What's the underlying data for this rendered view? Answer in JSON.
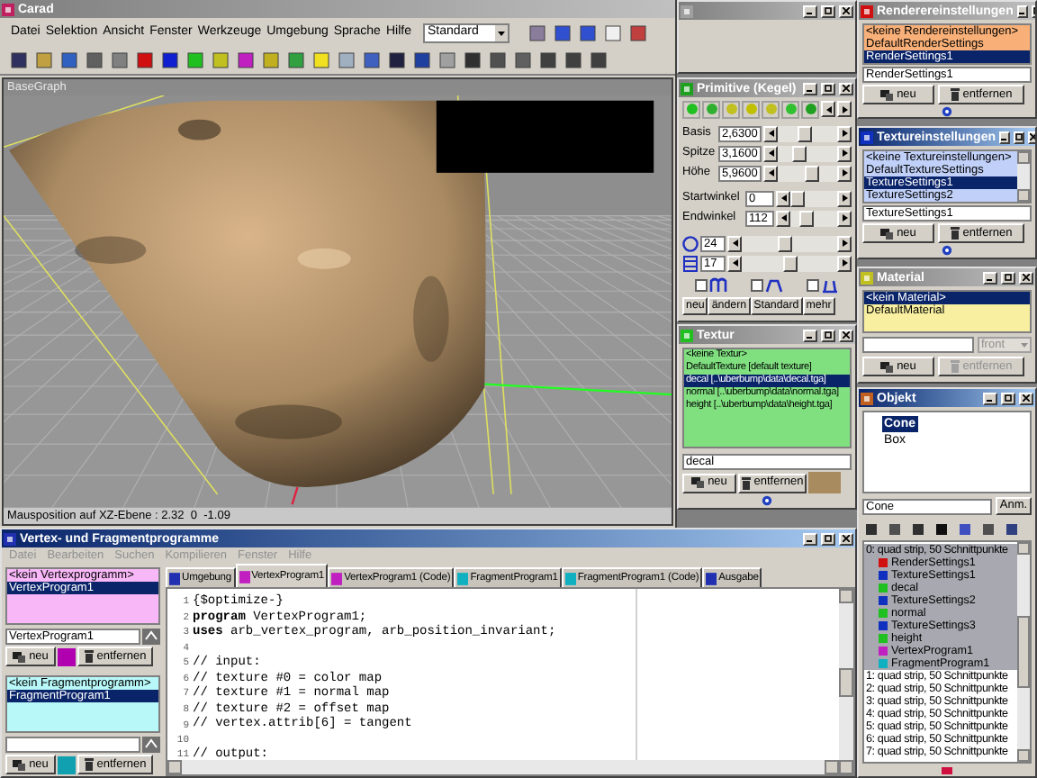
{
  "main": {
    "title": "Carad",
    "menu": [
      "Datei",
      "Selektion",
      "Ansicht",
      "Fenster",
      "Werkzeuge",
      "Umgebung",
      "Sprache",
      "Hilfe"
    ],
    "view_select": {
      "value": "Standard"
    }
  },
  "viewport": {
    "title": "BaseGraph",
    "status": "Mausposition auf XZ-Ebene : 2.32  0  -1.09"
  },
  "primitive": {
    "title": "Primitive (Kegel)",
    "active": false,
    "params": [
      {
        "label": "Basis",
        "value": "2,6300",
        "level": 0.45
      },
      {
        "label": "Spitze",
        "value": "3,1600",
        "level": 0.3
      },
      {
        "label": "Höhe",
        "value": "5,9600",
        "level": 0.6
      }
    ],
    "angles": [
      {
        "label": "Startwinkel",
        "value": "0",
        "level": 0.0
      },
      {
        "label": "Endwinkel",
        "value": "112",
        "level": 0.3
      }
    ],
    "segments": [
      {
        "kind": "circle",
        "value": "24",
        "level": 0.45
      },
      {
        "kind": "rings",
        "value": "17",
        "level": 0.5
      }
    ],
    "profiles": [
      {
        "kind": "arches",
        "checked": false
      },
      {
        "kind": "hat",
        "checked": false
      },
      {
        "kind": "tray",
        "checked": false
      }
    ],
    "buttons": [
      "neu",
      "ändern",
      "Standard",
      "mehr"
    ]
  },
  "textur": {
    "title": "Textur",
    "active": false,
    "items": [
      {
        "label": "<keine Textur>",
        "selected": false
      },
      {
        "label": "DefaultTexture  [default texture]",
        "selected": false
      },
      {
        "label": "decal  [..\\uberbump\\data\\decal.tga]",
        "selected": true
      },
      {
        "label": "normal  [..\\uberbump\\data\\normal.tga]",
        "selected": false
      },
      {
        "label": "height  [..\\uberbump\\data\\height.tga]",
        "selected": false
      }
    ],
    "name": "decal",
    "buttons": [
      "neu",
      "entfernen"
    ]
  },
  "render_settings": {
    "title": "Renderereinstellungen",
    "active": false,
    "items": [
      {
        "label": "<keine Rendereinstellungen>",
        "selected": false
      },
      {
        "label": "DefaultRenderSettings",
        "selected": false
      },
      {
        "label": "RenderSettings1",
        "selected": true
      }
    ],
    "name": "RenderSettings1",
    "buttons": [
      "neu",
      "entfernen"
    ]
  },
  "texture_settings": {
    "title": "Textureinstellungen",
    "active": true,
    "items": [
      {
        "label": "<keine Textureinstellungen>",
        "selected": false
      },
      {
        "label": "DefaultTextureSettings",
        "selected": false
      },
      {
        "label": "TextureSettings1",
        "selected": true
      },
      {
        "label": "TextureSettings2",
        "selected": false
      }
    ],
    "name": "TextureSettings1",
    "buttons": [
      "neu",
      "entfernen"
    ]
  },
  "material": {
    "title": "Material",
    "active": false,
    "items": [
      {
        "label": "<kein Material>",
        "selected": true
      },
      {
        "label": "DefaultMaterial",
        "selected": false
      }
    ],
    "face": {
      "value": "front",
      "disabled": true
    },
    "buttons": [
      {
        "label": "neu",
        "disabled": false
      },
      {
        "label": "entfernen",
        "disabled": true
      }
    ]
  },
  "objekt": {
    "title": "Objekt",
    "active": true,
    "tree": [
      {
        "label": "Cone",
        "selected": true
      },
      {
        "label": "Box",
        "selected": false
      }
    ],
    "name": "Cone",
    "apply": "Anm.",
    "primitives": [
      {
        "label": "0: quad strip, 50 Schnittpunkte",
        "selected": true,
        "children": [
          {
            "label": "RenderSettings1",
            "kind": "render"
          },
          {
            "label": "TextureSettings1",
            "kind": "texsettings"
          },
          {
            "label": "decal",
            "kind": "texture"
          },
          {
            "label": "TextureSettings2",
            "kind": "texsettings"
          },
          {
            "label": "normal",
            "kind": "texture"
          },
          {
            "label": "TextureSettings3",
            "kind": "texsettings"
          },
          {
            "label": "height",
            "kind": "texture"
          },
          {
            "label": "VertexProgram1",
            "kind": "vertex"
          },
          {
            "label": "FragmentProgram1",
            "kind": "fragment"
          }
        ]
      },
      {
        "label": "1: quad strip, 50 Schnittpunkte",
        "selected": false
      },
      {
        "label": "2: quad strip, 50 Schnittpunkte",
        "selected": false
      },
      {
        "label": "3: quad strip, 50 Schnittpunkte",
        "selected": false
      },
      {
        "label": "4: quad strip, 50 Schnittpunkte",
        "selected": false
      },
      {
        "label": "5: quad strip, 50 Schnittpunkte",
        "selected": false
      },
      {
        "label": "6: quad strip, 50 Schnittpunkte",
        "selected": false
      },
      {
        "label": "7: quad strip, 50 Schnittpunkte",
        "selected": false
      }
    ]
  },
  "programs": {
    "title": "Vertex- und Fragmentprogramme",
    "active": true,
    "menu": {
      "disabled": true,
      "items": [
        "Datei",
        "Bearbeiten",
        "Suchen",
        "Kompilieren",
        "Fenster",
        "Hilfe"
      ]
    },
    "vertex": {
      "items": [
        {
          "label": "<kein Vertexprogramm>",
          "selected": false
        },
        {
          "label": "VertexProgram1",
          "selected": true
        }
      ],
      "name": "VertexProgram1",
      "buttons": [
        "neu",
        "entfernen"
      ]
    },
    "fragment": {
      "items": [
        {
          "label": "<kein Fragmentprogramm>",
          "selected": false
        },
        {
          "label": "FragmentProgram1",
          "selected": true
        }
      ],
      "buttons": [
        "neu",
        "entfernen"
      ]
    },
    "tabs": [
      {
        "label": "Umgebung",
        "kind": "env",
        "selected": false
      },
      {
        "label": "VertexProgram1",
        "kind": "vertex",
        "selected": true
      },
      {
        "label": "VertexProgram1 (Code)",
        "kind": "vertex",
        "selected": false
      },
      {
        "label": "FragmentProgram1",
        "kind": "fragment",
        "selected": false
      },
      {
        "label": "FragmentProgram1 (Code)",
        "kind": "fragment",
        "selected": false
      },
      {
        "label": "Ausgabe",
        "kind": "env",
        "selected": false
      }
    ],
    "code": [
      {
        "no": "1",
        "text": "{$optimize-}"
      },
      {
        "no": "2",
        "text": "**program** VertexProgram1;"
      },
      {
        "no": "3",
        "text": "**uses** arb_vertex_program, arb_position_invariant;"
      },
      {
        "no": "4"
      },
      {
        "no": "5",
        "text": "// input:"
      },
      {
        "no": "6",
        "text": "// texture #0 = color map"
      },
      {
        "no": "7",
        "text": "// texture #1 = normal map"
      },
      {
        "no": "8",
        "text": "// texture #2 = offset map"
      },
      {
        "no": "9",
        "text": "// vertex.attrib[6] = tangent"
      },
      {
        "no": "10"
      },
      {
        "no": "11",
        "text": "// output:"
      }
    ]
  }
}
